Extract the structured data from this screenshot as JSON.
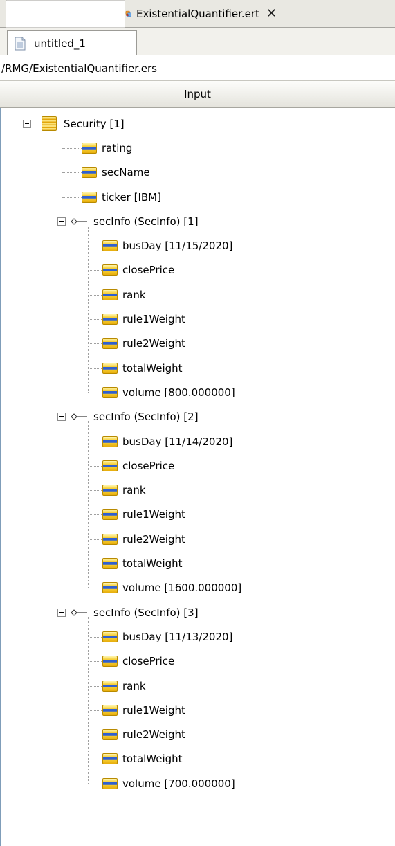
{
  "editor_tab": {
    "title": "ExistentialQuantifier.ert",
    "close_icon": "close-icon"
  },
  "sub_tab": {
    "label": "untitled_1"
  },
  "path": "/RMG/ExistentialQuantifier.ers",
  "column_header": "Input",
  "tree": [
    {
      "label": "Security [1]",
      "kind": "class",
      "depth": 0
    },
    {
      "label": "rating",
      "kind": "field",
      "depth": 1
    },
    {
      "label": "secName",
      "kind": "field",
      "depth": 1
    },
    {
      "label": "ticker [IBM]",
      "kind": "field",
      "depth": 1
    },
    {
      "label": "secInfo (SecInfo) [1]",
      "kind": "relation",
      "depth": 1
    },
    {
      "label": "busDay [11/15/2020]",
      "kind": "field",
      "depth": 2
    },
    {
      "label": "closePrice",
      "kind": "field",
      "depth": 2
    },
    {
      "label": "rank",
      "kind": "field",
      "depth": 2
    },
    {
      "label": "rule1Weight",
      "kind": "field",
      "depth": 2
    },
    {
      "label": "rule2Weight",
      "kind": "field",
      "depth": 2
    },
    {
      "label": "totalWeight",
      "kind": "field",
      "depth": 2
    },
    {
      "label": "volume [800.000000]",
      "kind": "field",
      "depth": 2
    },
    {
      "label": "secInfo (SecInfo) [2]",
      "kind": "relation",
      "depth": 1
    },
    {
      "label": "busDay [11/14/2020]",
      "kind": "field",
      "depth": 2
    },
    {
      "label": "closePrice",
      "kind": "field",
      "depth": 2
    },
    {
      "label": "rank",
      "kind": "field",
      "depth": 2
    },
    {
      "label": "rule1Weight",
      "kind": "field",
      "depth": 2
    },
    {
      "label": "rule2Weight",
      "kind": "field",
      "depth": 2
    },
    {
      "label": "totalWeight",
      "kind": "field",
      "depth": 2
    },
    {
      "label": "volume [1600.000000]",
      "kind": "field",
      "depth": 2
    },
    {
      "label": "secInfo (SecInfo) [3]",
      "kind": "relation",
      "depth": 1
    },
    {
      "label": "busDay [11/13/2020]",
      "kind": "field",
      "depth": 2
    },
    {
      "label": "closePrice",
      "kind": "field",
      "depth": 2
    },
    {
      "label": "rank",
      "kind": "field",
      "depth": 2
    },
    {
      "label": "rule1Weight",
      "kind": "field",
      "depth": 2
    },
    {
      "label": "rule2Weight",
      "kind": "field",
      "depth": 2
    },
    {
      "label": "totalWeight",
      "kind": "field",
      "depth": 2
    },
    {
      "label": "volume [700.000000]",
      "kind": "field",
      "depth": 2
    }
  ]
}
